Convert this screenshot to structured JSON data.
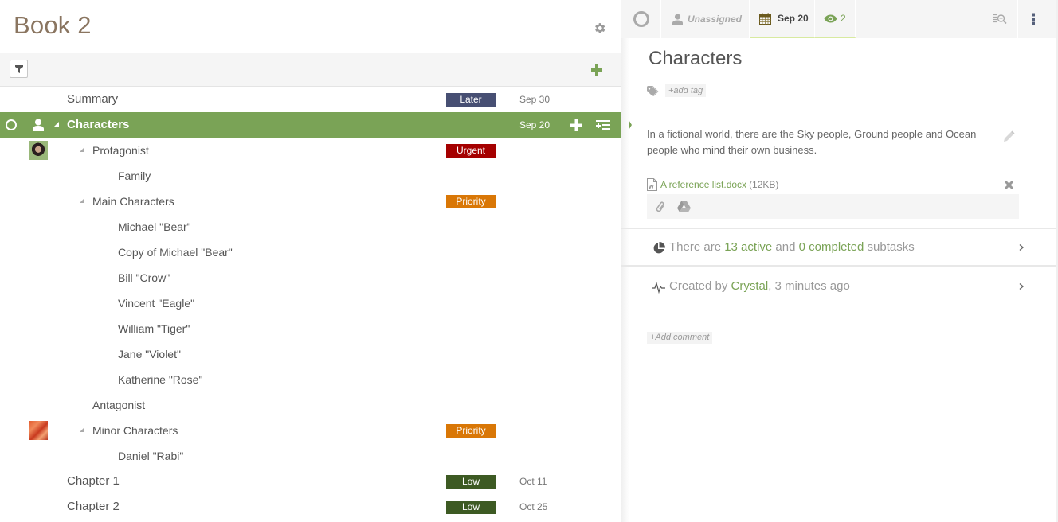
{
  "project": {
    "title": "Book 2"
  },
  "icons": {
    "settings": "gear-icon",
    "filter": "filter-icon",
    "add": "plus-icon",
    "status": "circle-icon",
    "assignee": "user-icon",
    "calendar": "calendar-icon",
    "watchers": "eye-icon",
    "search_list": "list-search-icon",
    "more": "vertical-dots-icon",
    "tag": "tag-icon",
    "edit": "pencil-icon",
    "word_file": "word-file-icon",
    "remove": "close-x-icon",
    "attach": "paperclip-icon",
    "drive": "google-drive-icon",
    "subtasks": "pie-chart-icon",
    "activity": "activity-pulse-icon",
    "chevron": "chevron-right-icon"
  },
  "colors": {
    "accent": "#7aa356",
    "title_brown": "#8a7560",
    "badge_later": "#474f73",
    "badge_urgent": "#a50000",
    "badge_priority": "#d97706",
    "badge_low": "#3d5a23"
  },
  "tree": [
    {
      "label": "Summary",
      "level": 0,
      "badge": "Later",
      "badge_color": "#474f73",
      "date": "Sep 30"
    },
    {
      "label": "Characters",
      "level": 0,
      "selected": true,
      "expanded": true,
      "date": "Sep 20"
    },
    {
      "label": "Protagonist",
      "level": 1,
      "expanded": true,
      "badge": "Urgent",
      "badge_color": "#a50000",
      "avatar": "woman-portrait"
    },
    {
      "label": "Family",
      "level": 2
    },
    {
      "label": "Main Characters",
      "level": 1,
      "expanded": true,
      "badge": "Priority",
      "badge_color": "#d97706"
    },
    {
      "label": "Michael \"Bear\"",
      "level": 2
    },
    {
      "label": "Copy of Michael \"Bear\"",
      "level": 2
    },
    {
      "label": "Bill \"Crow\"",
      "level": 2
    },
    {
      "label": "Vincent \"Eagle\"",
      "level": 2
    },
    {
      "label": "William \"Tiger\"",
      "level": 2
    },
    {
      "label": "Jane \"Violet\"",
      "level": 2
    },
    {
      "label": "Katherine \"Rose\"",
      "level": 2
    },
    {
      "label": "Antagonist",
      "level": 1
    },
    {
      "label": "Minor Characters",
      "level": 1,
      "expanded": true,
      "badge": "Priority",
      "badge_color": "#d97706",
      "avatar": "red-leaves"
    },
    {
      "label": "Daniel \"Rabi\"",
      "level": 2
    },
    {
      "label": "Chapter 1",
      "level": 0,
      "badge": "Low",
      "badge_color": "#3d5a23",
      "date": "Oct 11"
    },
    {
      "label": "Chapter 2",
      "level": 0,
      "badge": "Low",
      "badge_color": "#3d5a23",
      "date": "Oct 25"
    }
  ],
  "detail": {
    "topbar": {
      "assignee": "Unassigned",
      "due_date": "Sep 20",
      "watchers": "2"
    },
    "title": "Characters",
    "add_tag": "+add tag",
    "description": "In a fictional world, there are the Sky people, Ground people and Ocean people who mind their own business.",
    "attachment": {
      "name": "A reference list.docx",
      "size": "(12KB)"
    },
    "subtasks": {
      "prefix": "There are ",
      "active": "13 active",
      "middle": " and ",
      "completed": "0 completed",
      "suffix": " subtasks"
    },
    "created": {
      "prefix": "Created by ",
      "author": "Crystal",
      "suffix": ", 3 minutes ago"
    },
    "add_comment": "+Add comment"
  }
}
